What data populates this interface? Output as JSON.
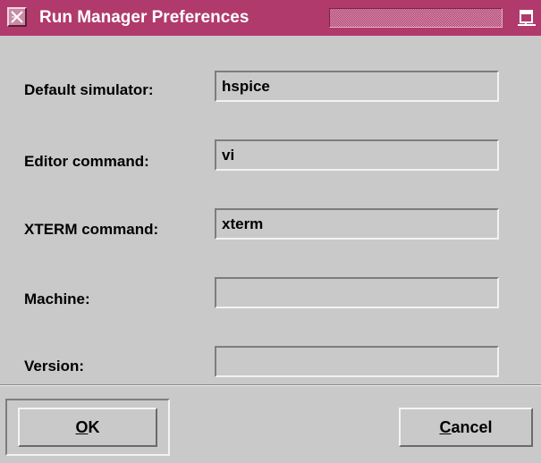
{
  "window": {
    "title": "Run Manager Preferences",
    "colors": {
      "titlebar": "#b03a6c",
      "background": "#c9c9c9"
    }
  },
  "form": {
    "rows": [
      {
        "label": "Default simulator:",
        "value": "hspice"
      },
      {
        "label": "Editor command:",
        "value": "vi"
      },
      {
        "label": "XTERM command:",
        "value": "xterm"
      },
      {
        "label": "Machine:",
        "value": ""
      },
      {
        "label": "Version:",
        "value": ""
      }
    ]
  },
  "buttons": {
    "ok": {
      "mnemonic": "O",
      "rest": "K"
    },
    "cancel": {
      "mnemonic": "C",
      "rest": "ancel"
    }
  },
  "icons": {
    "window_menu": "window-menu-icon",
    "maximize": "maximize-icon"
  }
}
